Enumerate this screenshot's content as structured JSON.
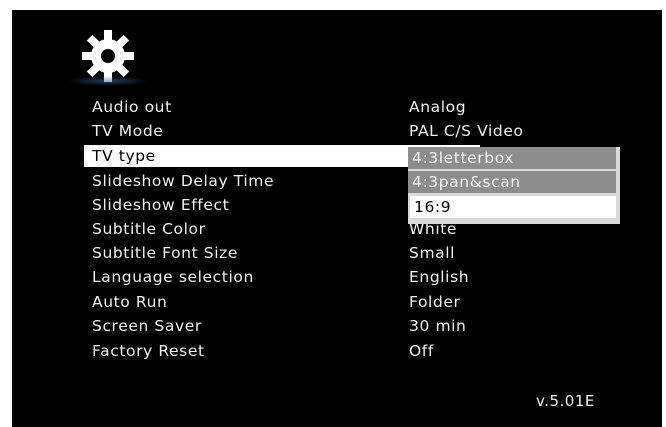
{
  "menu": {
    "items": [
      {
        "label": "Audio out",
        "value": "Analog"
      },
      {
        "label": "TV Mode",
        "value": "PAL C/S Video"
      },
      {
        "label": "TV type",
        "value": ""
      },
      {
        "label": "Slideshow Delay Time",
        "value": ""
      },
      {
        "label": "Slideshow Effect",
        "value": ""
      },
      {
        "label": "Subtitle Color",
        "value": "White"
      },
      {
        "label": "Subtitle Font Size",
        "value": "Small"
      },
      {
        "label": "Language selection",
        "value": "English"
      },
      {
        "label": "Auto Run",
        "value": "Folder"
      },
      {
        "label": "Screen Saver",
        "value": "30 min"
      },
      {
        "label": "Factory Reset",
        "value": "Off"
      }
    ],
    "selected_item": "TV type"
  },
  "dropdown": {
    "options": [
      "4:3letterbox",
      "4:3pan&scan",
      "16:9"
    ],
    "selected": "16:9"
  },
  "version": "v.5.01E",
  "colors": {
    "background": "#000000",
    "text": "#f2f2f2",
    "highlight": "#ffffff",
    "dropdown_option": "#8d8d8d"
  },
  "icons": {
    "header": "gear-icon"
  }
}
